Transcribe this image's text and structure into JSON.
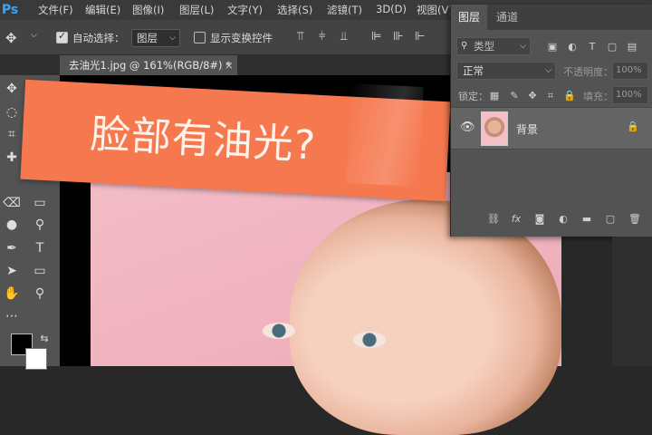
{
  "app": {
    "logo": "Ps"
  },
  "menu": [
    "文件(F)",
    "编辑(E)",
    "图像(I)",
    "图层(L)",
    "文字(Y)",
    "选择(S)",
    "滤镜(T)",
    "3D(D)",
    "视图(V)"
  ],
  "options": {
    "auto_select_label": "自动选择：",
    "auto_select_value": "图层",
    "show_transform_label": "显示变换控件"
  },
  "document_tab": {
    "title": "去油光1.jpg @ 161%(RGB/8#) *",
    "close": "×"
  },
  "banner": {
    "text": "脸部有油光?",
    "color": "#f5784f"
  },
  "layers_panel": {
    "tabs": [
      "图层",
      "通道"
    ],
    "filter_label": "类型",
    "blend_mode": "正常",
    "opacity_label": "不透明度：",
    "opacity_value": "100%",
    "lock_label": "锁定：",
    "fill_label": "填充：",
    "fill_value": "100%",
    "layers": [
      {
        "name": "背景",
        "visible": true,
        "locked": true
      }
    ]
  },
  "tools": [
    "move-tool",
    "lasso-tool",
    "crop-tool",
    "healing-brush-tool",
    "eraser-tool",
    "gradient-tool",
    "blur-tool",
    "dodge-tool",
    "pen-tool",
    "text-tool",
    "path-selection-tool",
    "rectangle-tool",
    "hand-tool",
    "zoom-tool",
    "more-tools"
  ],
  "colors": {
    "foreground": "#000000",
    "background": "#ffffff",
    "accent": "#31a8ff"
  }
}
